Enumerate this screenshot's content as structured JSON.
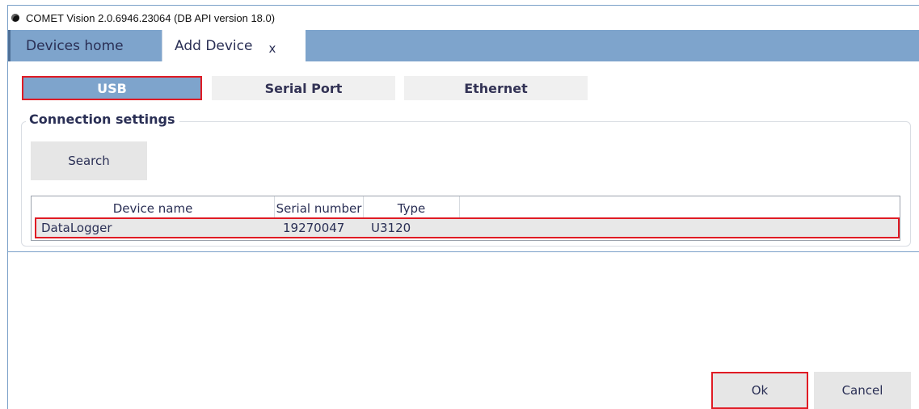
{
  "window": {
    "title": "COMET Vision 2.0.6946.23064 (DB API version 18.0)"
  },
  "tabs": [
    {
      "label": "Devices home"
    },
    {
      "label": "Add Device",
      "close": "x"
    }
  ],
  "connection_modes": [
    "USB",
    "Serial Port",
    "Ethernet"
  ],
  "connection_settings": {
    "legend": "Connection settings",
    "search_label": "Search",
    "table": {
      "columns": [
        "Device name",
        "Serial number",
        "Type"
      ],
      "rows": [
        {
          "name": "DataLogger",
          "serial": "19270047",
          "type": "U3120"
        }
      ]
    }
  },
  "footer": {
    "ok_label": "Ok",
    "cancel_label": "Cancel"
  },
  "colors": {
    "accent": "#7ea4cc",
    "highlight": "#e01b24"
  }
}
